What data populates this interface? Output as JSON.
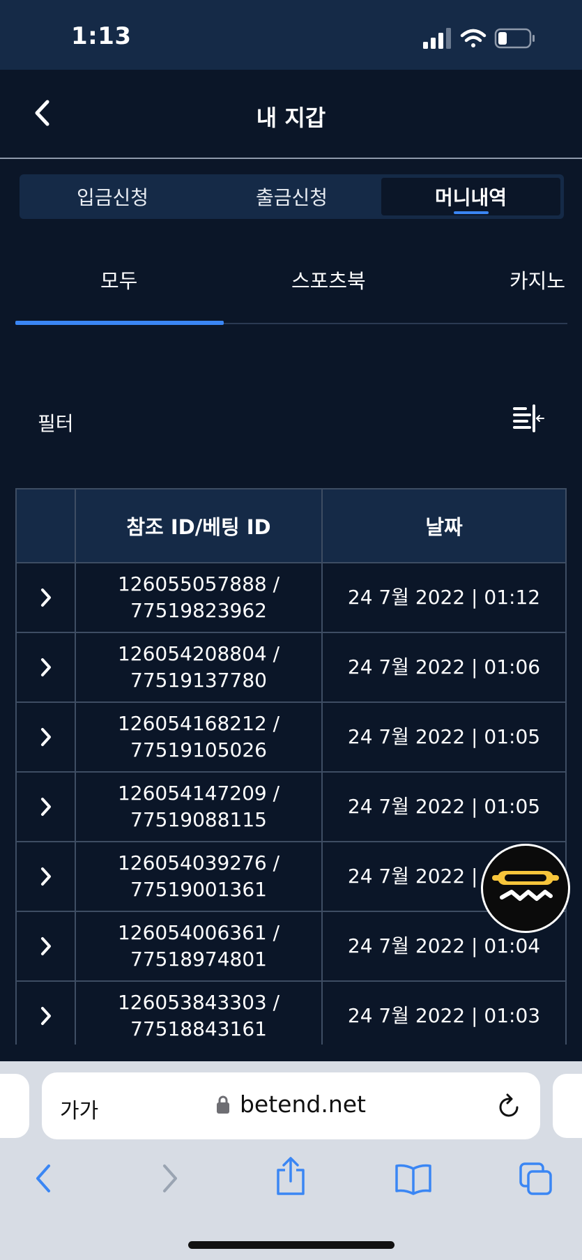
{
  "status_bar": {
    "time": "1:13"
  },
  "header": {
    "title": "내 지갑"
  },
  "wallet_tabs": [
    {
      "label": "입금신청",
      "active": false
    },
    {
      "label": "출금신청",
      "active": false
    },
    {
      "label": "머니내역",
      "active": true
    }
  ],
  "category_tabs": [
    {
      "label": "모두",
      "active": true
    },
    {
      "label": "스포츠북",
      "active": false
    },
    {
      "label": "카지노",
      "active": false
    }
  ],
  "filter": {
    "label": "필터"
  },
  "table": {
    "headers": [
      "",
      "참조 ID/베팅 ID",
      "날짜"
    ],
    "rows": [
      {
        "ref_id": "126055057888 /",
        "bet_id": "77519823962",
        "date": "24 7월 2022 | 01:12"
      },
      {
        "ref_id": "126054208804 /",
        "bet_id": "77519137780",
        "date": "24 7월 2022 | 01:06"
      },
      {
        "ref_id": "126054168212 /",
        "bet_id": "77519105026",
        "date": "24 7월 2022 | 01:05"
      },
      {
        "ref_id": "126054147209 /",
        "bet_id": "77519088115",
        "date": "24 7월 2022 | 01:05"
      },
      {
        "ref_id": "126054039276 /",
        "bet_id": "77519001361",
        "date": "24 7월 2022 | 01:04"
      },
      {
        "ref_id": "126054006361 /",
        "bet_id": "77518974801",
        "date": "24 7월 2022 | 01:04"
      },
      {
        "ref_id": "126053843303 /",
        "bet_id": "77518843161",
        "date": "24 7월 2022 | 01:03"
      },
      {
        "ref_id": "",
        "bet_id": "",
        "date": ""
      }
    ]
  },
  "browser": {
    "aa_label": "가가",
    "url": "betend.net"
  },
  "colors": {
    "background": "#0b1628",
    "panel": "#152a47",
    "accent": "#3a86f4",
    "border": "#3e4d63",
    "logo_yellow": "#f7c53b"
  },
  "icons": {
    "back": "chevron-left-icon",
    "row_expand": "chevron-right-icon",
    "filter": "filter-collapse-icon",
    "lock": "lock-icon",
    "reload": "reload-icon",
    "share": "share-icon",
    "bookmarks": "bookmarks-icon",
    "tabs": "tabs-icon"
  }
}
